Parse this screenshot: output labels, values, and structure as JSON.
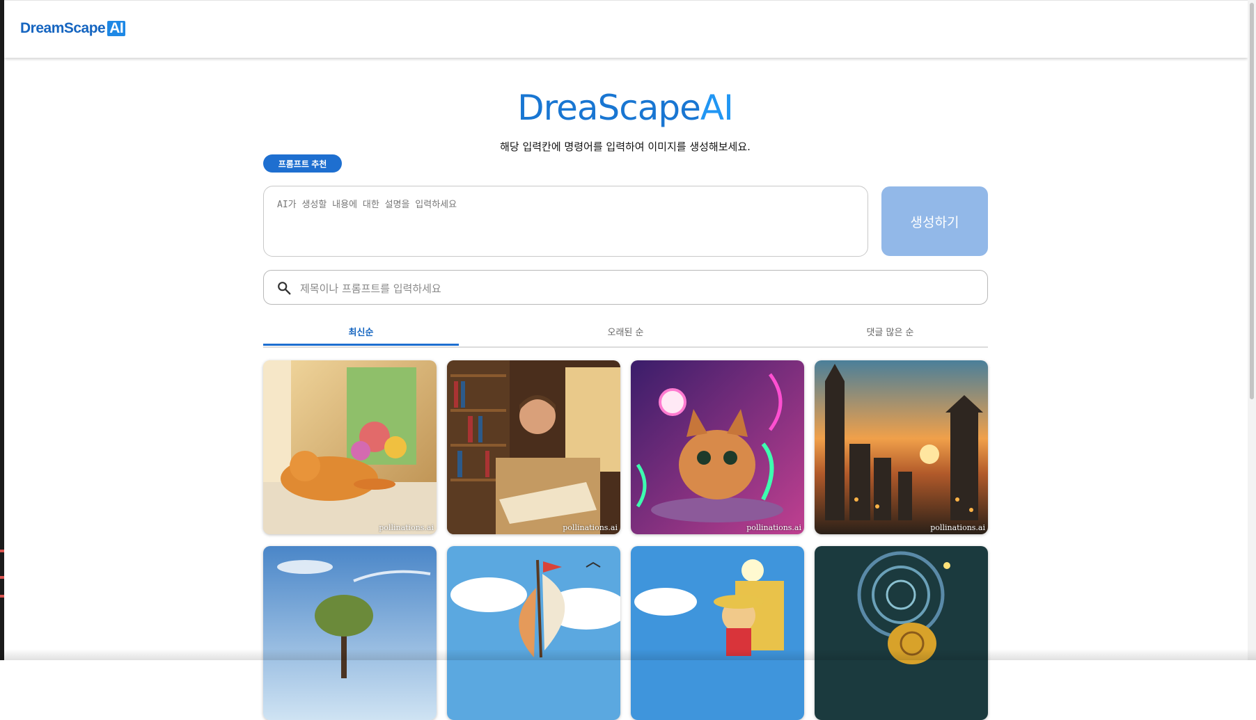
{
  "header": {
    "logo_text": "DreamScape",
    "logo_badge": "AI"
  },
  "hero": {
    "title_main": "DreaScape",
    "title_ai": "AI",
    "subtitle": "해당 입력칸에 명령어를 입력하여 이미지를 생성해보세요."
  },
  "prompt": {
    "recommend_label": "프롬프트 추천",
    "placeholder": "AI가 생성할 내용에 대한 설명을 입력하세요",
    "value": "",
    "generate_label": "생성하기"
  },
  "search": {
    "placeholder": "제목이나 프롬프트를 입력하세요",
    "value": ""
  },
  "sort_tabs": [
    {
      "label": "최신순",
      "active": true
    },
    {
      "label": "오래된 순",
      "active": false
    },
    {
      "label": "댓글 많은 순",
      "active": false
    }
  ],
  "gallery": {
    "watermark": "pollinations.ai",
    "images": [
      "cat sleeping on sunny windowsill",
      "man reading book in library",
      "cat in neon-lit room",
      "fantasy city at sunset",
      "lone tree on grassy hill",
      "sailing ship among clouds",
      "pirate boy on boat",
      "snail under spiral galaxy"
    ]
  },
  "colors": {
    "accent": "#1e6fd0",
    "title_blue": "#1976d2",
    "generate_disabled": "#92b8e8"
  }
}
